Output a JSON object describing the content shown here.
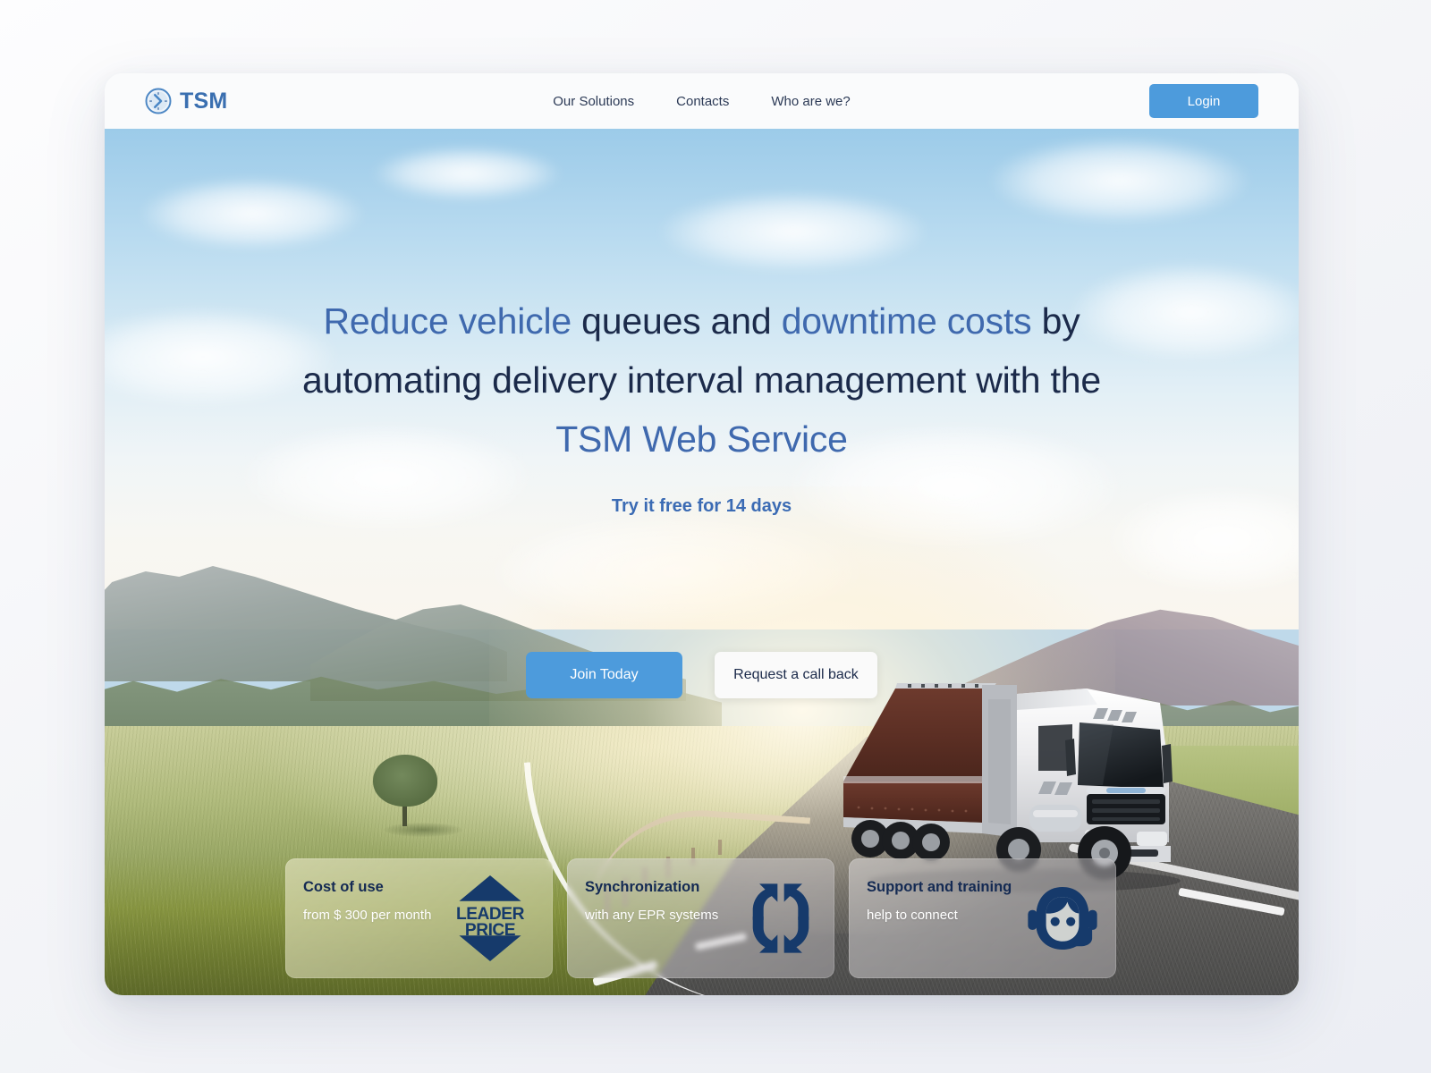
{
  "brand": {
    "name": "TSM",
    "logo_icon": "clock-icon",
    "accent_color": "#3a6fb0"
  },
  "header": {
    "nav": [
      {
        "label": "Our Solutions"
      },
      {
        "label": "Contacts"
      },
      {
        "label": "Who are we?"
      }
    ],
    "login_label": "Login",
    "login_color": "#4d9bdc"
  },
  "hero": {
    "headline": {
      "part1": "Reduce vehicle ",
      "part2": "queues and ",
      "part3": "downtime costs ",
      "part4": "by",
      "line2": "automating delivery interval management with the",
      "line3": "TSM Web Service",
      "accent_color": "#3f69ae",
      "body_color": "#1b2a4a"
    },
    "subhead": "Try it free for 14 days",
    "primary_cta": "Join Today",
    "secondary_cta": "Request a call back"
  },
  "features": [
    {
      "title": "Cost of use",
      "subtitle": "from $ 300 per month",
      "icon": "leader-price-badge-icon",
      "badge_line1": "LEADER",
      "badge_line2": "PRICE"
    },
    {
      "title": "Synchronization",
      "subtitle": "with any EPR systems",
      "icon": "sync-arrows-icon"
    },
    {
      "title": "Support and training",
      "subtitle": "help to connect",
      "icon": "support-headset-icon"
    }
  ]
}
